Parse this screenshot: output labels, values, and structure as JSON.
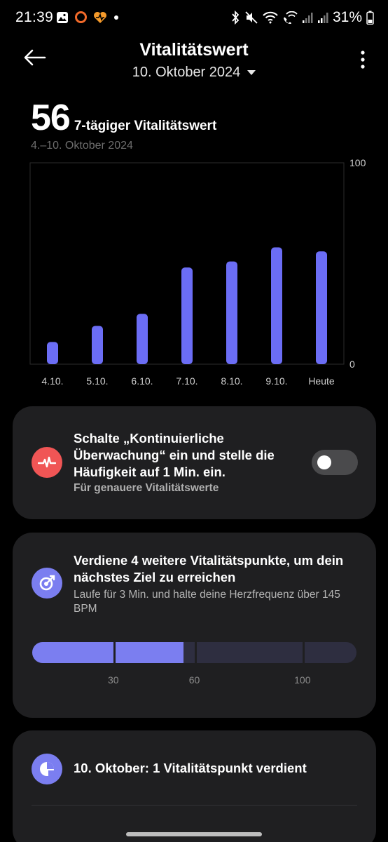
{
  "status_bar": {
    "time": "21:39",
    "battery": "31%",
    "icons_left": [
      "image-icon",
      "ring-icon",
      "heart-app-icon",
      "dot-icon"
    ],
    "icons_right": [
      "bluetooth-icon",
      "mute-icon",
      "wifi-icon",
      "wifi-calling-icon",
      "signal-icon",
      "signal-icon",
      "battery-icon"
    ]
  },
  "header": {
    "title": "Vitalitätswert",
    "date": "10. Oktober 2024"
  },
  "summary": {
    "score": "56",
    "score_label": "7-tägiger Vitalitätswert",
    "range": "4.–10. Oktober 2024"
  },
  "chart_data": {
    "type": "bar",
    "categories": [
      "4.10.",
      "5.10.",
      "6.10.",
      "7.10.",
      "8.10.",
      "9.10.",
      "Heute"
    ],
    "values": [
      11,
      19,
      25,
      48,
      51,
      58,
      56
    ],
    "ylim": [
      0,
      100
    ],
    "y_ticks": [
      "100",
      "0"
    ],
    "bar_color": "#6b6df5"
  },
  "card_monitoring": {
    "title": "Schalte „Kontinuierliche Überwachung“ ein und stelle die Häufigkeit auf 1 Min. ein.",
    "subtitle": "Für genauere Vitalitätswerte",
    "toggle_on": false,
    "icon": "heart-rate-icon",
    "icon_color": "#f05555"
  },
  "card_goal": {
    "title": "Verdiene 4 weitere Vitalitätspunkte, um dein nächstes Ziel zu erreichen",
    "subtitle": "Laufe für 3 Min. und halte deine Herzfrequenz über 145 BPM",
    "icon": "target-arrow-icon",
    "progress_value": 56,
    "progress_max": 120,
    "ticks": [
      "30",
      "60",
      "100"
    ],
    "tick_values": [
      30,
      60,
      100
    ],
    "fill_color": "#7b7ef0",
    "empty_color": "#2e2e40"
  },
  "card_day": {
    "title": "10. Oktober: 1 Vitalitätspunkt verdient",
    "icon": "pie-chart-icon"
  }
}
